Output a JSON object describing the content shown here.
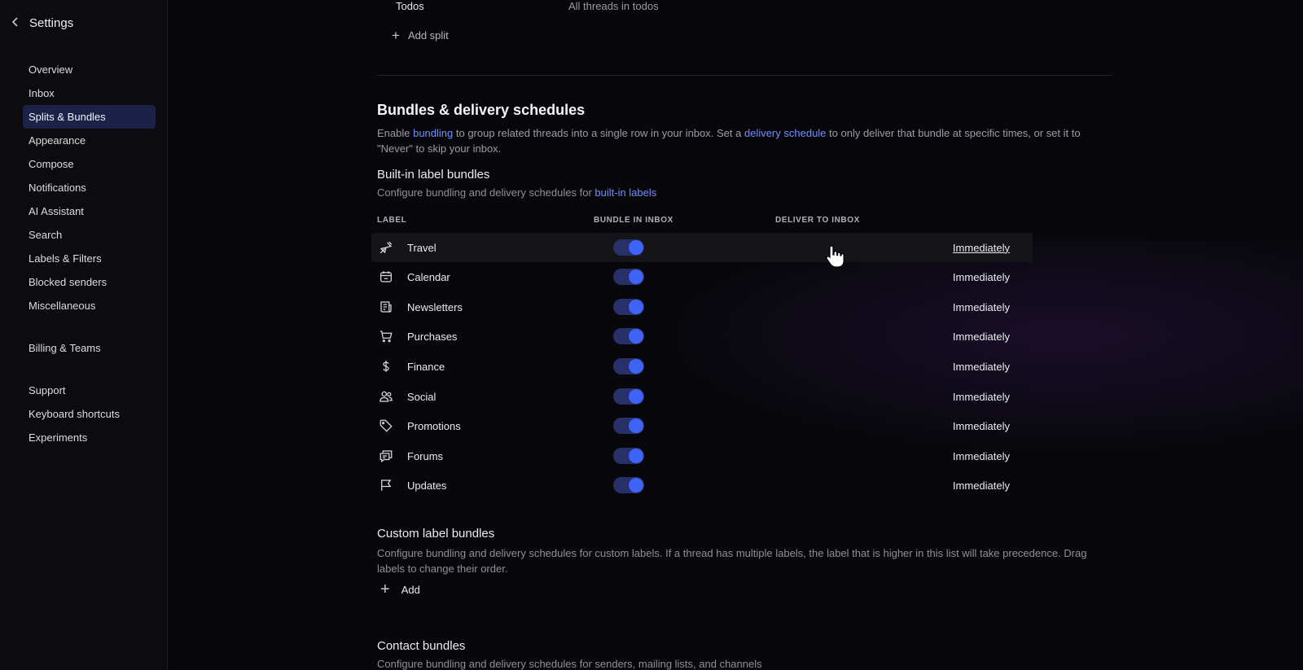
{
  "sidebar": {
    "title": "Settings",
    "items": [
      {
        "label": "Overview"
      },
      {
        "label": "Inbox"
      },
      {
        "label": "Splits & Bundles"
      },
      {
        "label": "Appearance"
      },
      {
        "label": "Compose"
      },
      {
        "label": "Notifications"
      },
      {
        "label": "AI Assistant"
      },
      {
        "label": "Search"
      },
      {
        "label": "Labels & Filters"
      },
      {
        "label": "Blocked senders"
      },
      {
        "label": "Miscellaneous"
      },
      {
        "label": "Billing & Teams"
      },
      {
        "label": "Support"
      },
      {
        "label": "Keyboard shortcuts"
      },
      {
        "label": "Experiments"
      }
    ],
    "active": "Splits & Bundles"
  },
  "splits": {
    "last_row": {
      "label": "Todos",
      "value": "All threads in todos"
    },
    "add_split": "Add split"
  },
  "bundles": {
    "title": "Bundles & delivery schedules",
    "desc_1": "Enable ",
    "desc_link_1": "bundling",
    "desc_2": " to group related threads into a single row in your inbox. Set a ",
    "desc_link_2": "delivery schedule",
    "desc_3": " to only deliver that bundle at specific times, or set it to \"Never\" to skip your inbox.",
    "builtin": {
      "title": "Built-in label bundles",
      "sub_1": "Configure bundling and delivery schedules for ",
      "sub_link": "built-in labels",
      "headers": {
        "label": "LABEL",
        "bundle": "BUNDLE IN INBOX",
        "deliver": "DELIVER TO INBOX"
      },
      "rows": [
        {
          "label": "Travel",
          "icon": "plane-icon",
          "bundle": true,
          "deliver": "Immediately"
        },
        {
          "label": "Calendar",
          "icon": "calendar-icon",
          "bundle": true,
          "deliver": "Immediately"
        },
        {
          "label": "Newsletters",
          "icon": "newspaper-icon",
          "bundle": true,
          "deliver": "Immediately"
        },
        {
          "label": "Purchases",
          "icon": "cart-icon",
          "bundle": true,
          "deliver": "Immediately"
        },
        {
          "label": "Finance",
          "icon": "dollar-icon",
          "bundle": true,
          "deliver": "Immediately"
        },
        {
          "label": "Social",
          "icon": "people-icon",
          "bundle": true,
          "deliver": "Immediately"
        },
        {
          "label": "Promotions",
          "icon": "tag-icon",
          "bundle": true,
          "deliver": "Immediately"
        },
        {
          "label": "Forums",
          "icon": "chat-icon",
          "bundle": true,
          "deliver": "Immediately"
        },
        {
          "label": "Updates",
          "icon": "flag-icon",
          "bundle": true,
          "deliver": "Immediately"
        }
      ]
    },
    "custom": {
      "title": "Custom label bundles",
      "sub": "Configure bundling and delivery schedules for custom labels. If a thread has multiple labels, the label that is higher in this list will take precedence. Drag labels to change their order.",
      "add": "Add"
    },
    "contact": {
      "title": "Contact bundles",
      "sub": "Configure bundling and delivery schedules for senders, mailing lists, and channels"
    }
  },
  "colors": {
    "accent": "#3f63f5",
    "link": "#6f8dff",
    "active_nav": "#1c2247"
  }
}
